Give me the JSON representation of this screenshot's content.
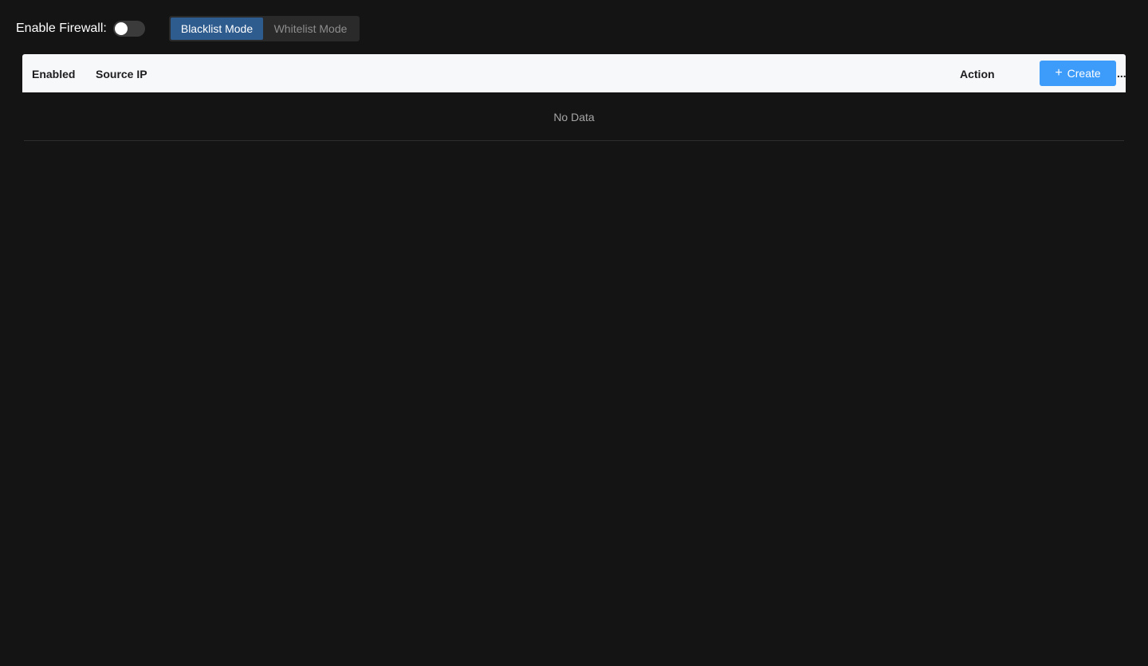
{
  "firewall": {
    "label": "Enable Firewall:",
    "enabled": false
  },
  "mode": {
    "options": [
      {
        "label": "Blacklist Mode",
        "selected": true
      },
      {
        "label": "Whitelist Mode",
        "selected": false
      }
    ]
  },
  "table": {
    "columns": {
      "enabled": "Enabled",
      "source_ip": "Source IP",
      "action": "Action"
    },
    "create_label": "Create",
    "create_icon": "plus-icon",
    "more_label": "...",
    "empty_text": "No Data",
    "rows": []
  },
  "colors": {
    "background": "#141414",
    "accent": "#3d9bf9",
    "selected_mode": "#2f5c8f",
    "header_bg": "#f7f8fa"
  }
}
